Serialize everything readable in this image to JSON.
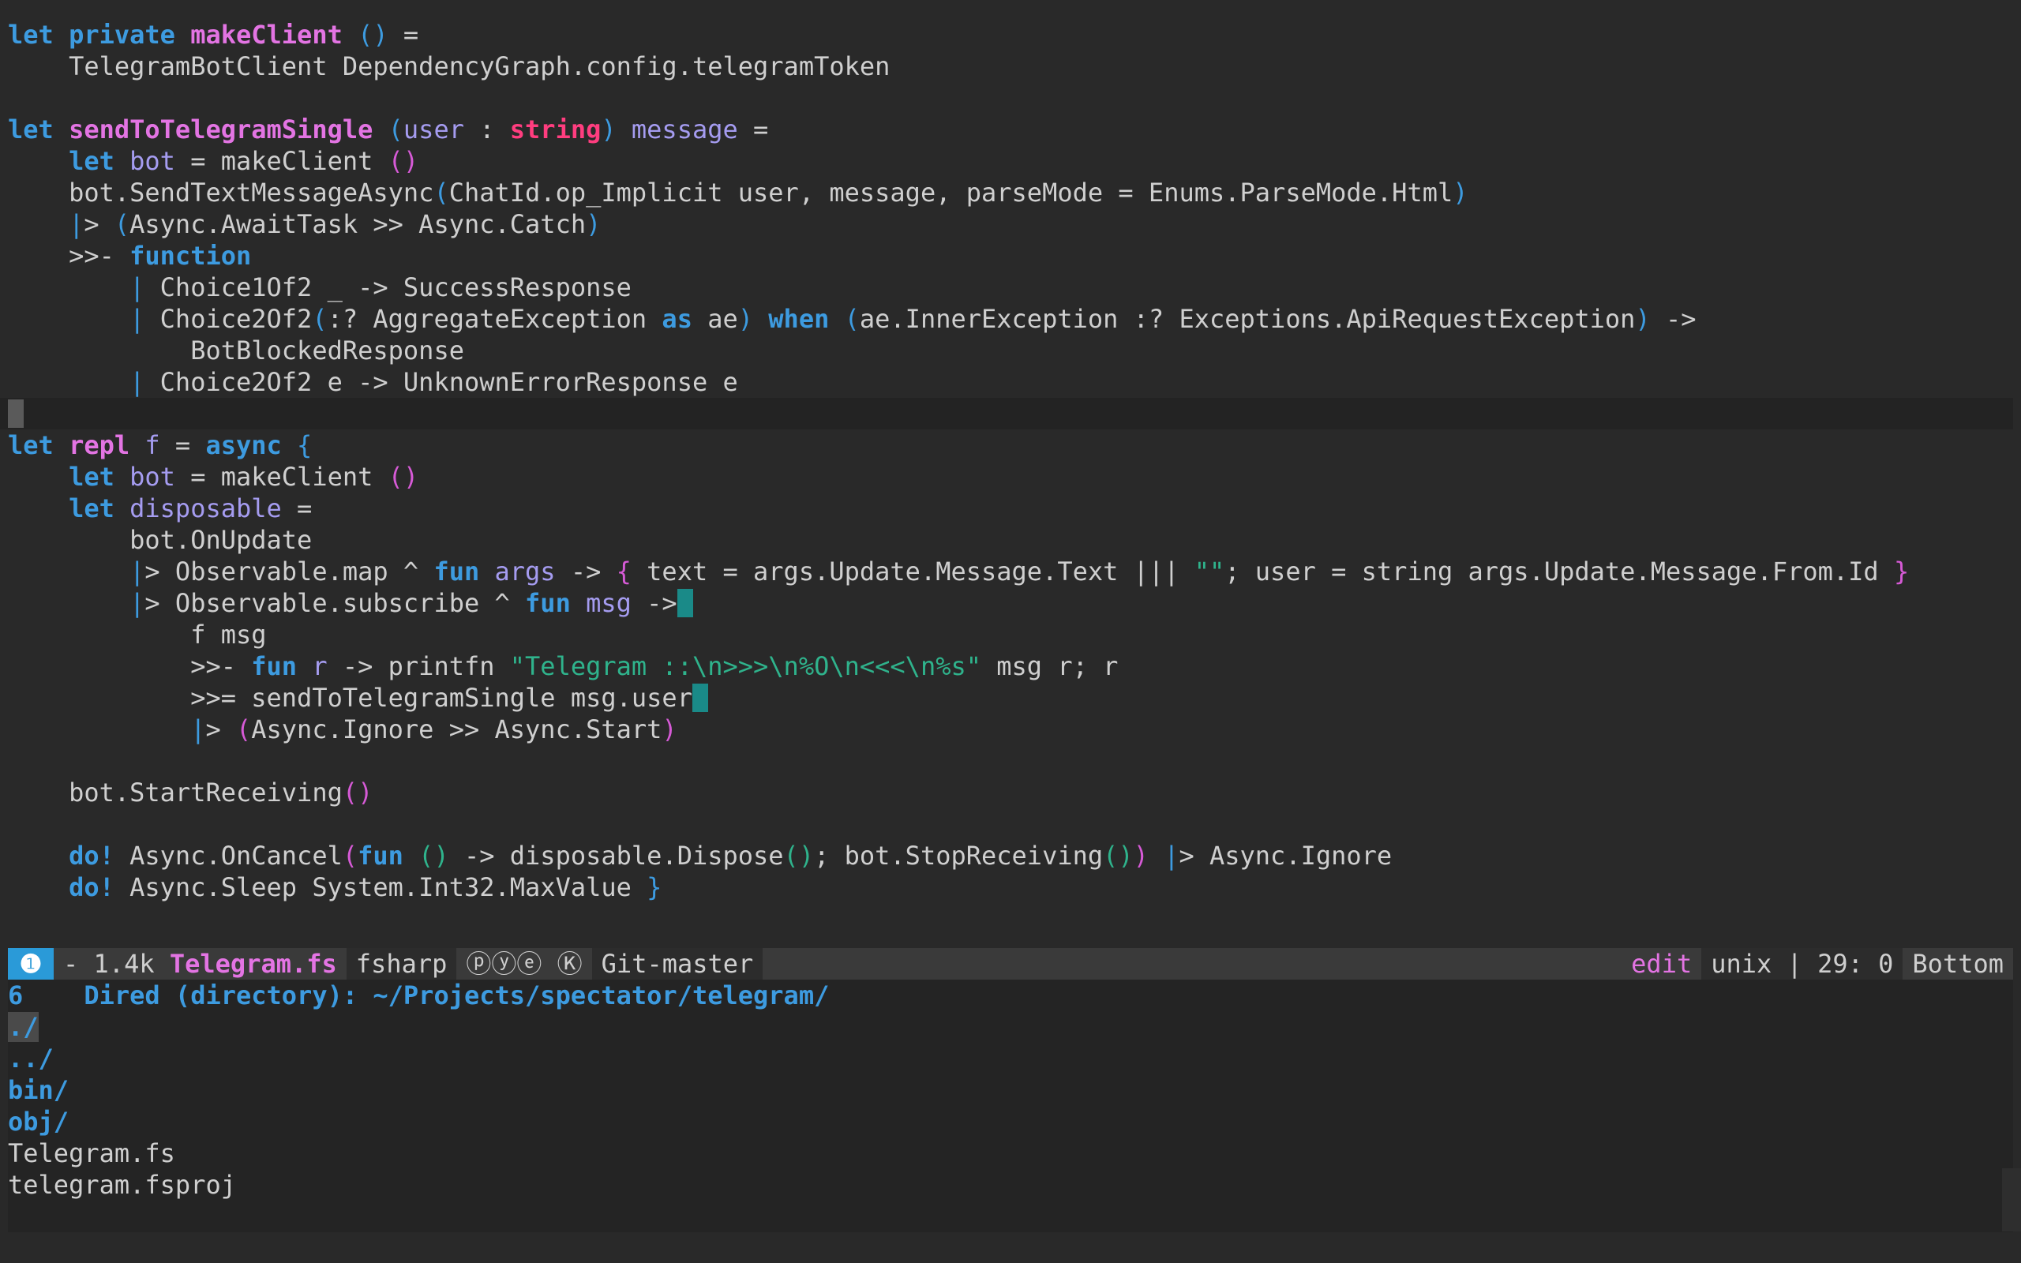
{
  "editor": {
    "lines": [
      {
        "segments": [
          {
            "t": "let",
            "c": "kw"
          },
          {
            "t": " "
          },
          {
            "t": "private",
            "c": "kw"
          },
          {
            "t": " "
          },
          {
            "t": "makeClient",
            "c": "fn"
          },
          {
            "t": " "
          },
          {
            "t": "()",
            "c": "p1"
          },
          {
            "t": " ="
          }
        ]
      },
      {
        "segments": [
          {
            "t": "    TelegramBotClient DependencyGraph.config.telegramToken"
          }
        ]
      },
      {
        "segments": []
      },
      {
        "segments": [
          {
            "t": "let",
            "c": "kw"
          },
          {
            "t": " "
          },
          {
            "t": "sendToTelegramSingle",
            "c": "fn"
          },
          {
            "t": " "
          },
          {
            "t": "(",
            "c": "p1"
          },
          {
            "t": "user",
            "c": "pr"
          },
          {
            "t": " : "
          },
          {
            "t": "string",
            "c": "ty"
          },
          {
            "t": ")",
            "c": "p1"
          },
          {
            "t": " "
          },
          {
            "t": "message",
            "c": "pr"
          },
          {
            "t": " ="
          }
        ]
      },
      {
        "segments": [
          {
            "t": "    "
          },
          {
            "t": "let",
            "c": "kw"
          },
          {
            "t": " "
          },
          {
            "t": "bot",
            "c": "pr"
          },
          {
            "t": " = makeClient "
          },
          {
            "t": "()",
            "c": "p2"
          }
        ]
      },
      {
        "segments": [
          {
            "t": "    bot.SendTextMessageAsync"
          },
          {
            "t": "(",
            "c": "p1"
          },
          {
            "t": "ChatId.op_Implicit user, message, parseMode = Enums.ParseMode.Html"
          },
          {
            "t": ")",
            "c": "p1"
          }
        ]
      },
      {
        "segments": [
          {
            "t": "    "
          },
          {
            "t": "|",
            "c": "pipe"
          },
          {
            "t": "> "
          },
          {
            "t": "(",
            "c": "p1"
          },
          {
            "t": "Async.AwaitTask >> Async.Catch"
          },
          {
            "t": ")",
            "c": "p1"
          }
        ]
      },
      {
        "segments": [
          {
            "t": "    >>- "
          },
          {
            "t": "function",
            "c": "kw"
          }
        ]
      },
      {
        "segments": [
          {
            "t": "        "
          },
          {
            "t": "|",
            "c": "pipe"
          },
          {
            "t": " Choice1Of2 _ -> SuccessResponse"
          }
        ]
      },
      {
        "segments": [
          {
            "t": "        "
          },
          {
            "t": "|",
            "c": "pipe"
          },
          {
            "t": " Choice2Of2"
          },
          {
            "t": "(",
            "c": "p1"
          },
          {
            "t": ":? AggregateException "
          },
          {
            "t": "as",
            "c": "kw"
          },
          {
            "t": " ae"
          },
          {
            "t": ")",
            "c": "p1"
          },
          {
            "t": " "
          },
          {
            "t": "when",
            "c": "kw"
          },
          {
            "t": " "
          },
          {
            "t": "(",
            "c": "p1"
          },
          {
            "t": "ae.InnerException :? Exceptions.ApiRequestException"
          },
          {
            "t": ")",
            "c": "p1"
          },
          {
            "t": " ->"
          }
        ]
      },
      {
        "segments": [
          {
            "t": "            BotBlockedResponse"
          }
        ]
      },
      {
        "segments": [
          {
            "t": "        "
          },
          {
            "t": "|",
            "c": "pipe"
          },
          {
            "t": " Choice2Of2 e -> UnknownErrorResponse e"
          }
        ]
      },
      {
        "segments": [],
        "cursor": "block",
        "highlight": true
      },
      {
        "segments": [
          {
            "t": "let",
            "c": "kw"
          },
          {
            "t": " "
          },
          {
            "t": "repl",
            "c": "fn"
          },
          {
            "t": " "
          },
          {
            "t": "f",
            "c": "pr"
          },
          {
            "t": " = "
          },
          {
            "t": "async",
            "c": "kw"
          },
          {
            "t": " "
          },
          {
            "t": "{",
            "c": "p1"
          }
        ]
      },
      {
        "segments": [
          {
            "t": "    "
          },
          {
            "t": "let",
            "c": "kw"
          },
          {
            "t": " "
          },
          {
            "t": "bot",
            "c": "pr"
          },
          {
            "t": " = makeClient "
          },
          {
            "t": "()",
            "c": "p2"
          }
        ]
      },
      {
        "segments": [
          {
            "t": "    "
          },
          {
            "t": "let",
            "c": "kw"
          },
          {
            "t": " "
          },
          {
            "t": "disposable",
            "c": "pr"
          },
          {
            "t": " ="
          }
        ]
      },
      {
        "segments": [
          {
            "t": "        bot.OnUpdate"
          }
        ]
      },
      {
        "segments": [
          {
            "t": "        "
          },
          {
            "t": "|",
            "c": "pipe"
          },
          {
            "t": "> Observable.map ^ "
          },
          {
            "t": "fun",
            "c": "kw"
          },
          {
            "t": " "
          },
          {
            "t": "args",
            "c": "pr"
          },
          {
            "t": " -> "
          },
          {
            "t": "{",
            "c": "p2"
          },
          {
            "t": " text = args.Update.Message.Text ||| "
          },
          {
            "t": "\"\"",
            "c": "st"
          },
          {
            "t": "; user = string args.Update.Message.From.Id "
          },
          {
            "t": "}",
            "c": "p2"
          }
        ]
      },
      {
        "segments": [
          {
            "t": "        "
          },
          {
            "t": "|",
            "c": "pipe"
          },
          {
            "t": "> Observable.subscribe ^ "
          },
          {
            "t": "fun",
            "c": "kw"
          },
          {
            "t": " "
          },
          {
            "t": "msg",
            "c": "pr"
          },
          {
            "t": " ->"
          }
        ],
        "cursor": "cyan"
      },
      {
        "segments": [
          {
            "t": "            f msg"
          }
        ]
      },
      {
        "segments": [
          {
            "t": "            >>- "
          },
          {
            "t": "fun",
            "c": "kw"
          },
          {
            "t": " "
          },
          {
            "t": "r",
            "c": "pr"
          },
          {
            "t": " -> printfn "
          },
          {
            "t": "\"Telegram ::\\n>>>\\n%O\\n<<<\\n%s\"",
            "c": "st"
          },
          {
            "t": " msg r; r"
          }
        ]
      },
      {
        "segments": [
          {
            "t": "            >>= sendToTelegramSingle msg.user"
          }
        ],
        "cursor": "cyan"
      },
      {
        "segments": [
          {
            "t": "            "
          },
          {
            "t": "|",
            "c": "pipe"
          },
          {
            "t": "> "
          },
          {
            "t": "(",
            "c": "p2"
          },
          {
            "t": "Async.Ignore >> Async.Start"
          },
          {
            "t": ")",
            "c": "p2"
          }
        ]
      },
      {
        "segments": []
      },
      {
        "segments": [
          {
            "t": "    bot.StartReceiving"
          },
          {
            "t": "()",
            "c": "p2"
          }
        ]
      },
      {
        "segments": []
      },
      {
        "segments": [
          {
            "t": "    "
          },
          {
            "t": "do!",
            "c": "kw"
          },
          {
            "t": " Async.OnCancel"
          },
          {
            "t": "(",
            "c": "p2"
          },
          {
            "t": "fun",
            "c": "kw"
          },
          {
            "t": " "
          },
          {
            "t": "()",
            "c": "p3"
          },
          {
            "t": " -> disposable.Dispose"
          },
          {
            "t": "()",
            "c": "p3"
          },
          {
            "t": "; bot.StopReceiving"
          },
          {
            "t": "()",
            "c": "p3"
          },
          {
            "t": ")",
            "c": "p2"
          },
          {
            "t": " "
          },
          {
            "t": "|",
            "c": "pipe"
          },
          {
            "t": "> Async.Ignore"
          }
        ]
      },
      {
        "segments": [
          {
            "t": "    "
          },
          {
            "t": "do!",
            "c": "kw"
          },
          {
            "t": " Async.Sleep System.Int32.MaxValue "
          },
          {
            "t": "}",
            "c": "p1"
          }
        ]
      }
    ]
  },
  "modeline": {
    "window_number": "❶",
    "modified": "-",
    "size": "1.4k",
    "filename": "Telegram.fs",
    "major_mode": "fsharp",
    "minor_modes": "ⓟⓨⓔ Ⓚ",
    "vcs": "Git-master",
    "state": "edit",
    "eol": "unix",
    "position": "29: 0",
    "scroll": "Bottom"
  },
  "dired": {
    "header_num": "6",
    "header": "Dired (directory): ~/Projects/spectator/telegram/",
    "entries": [
      {
        "name": "./",
        "kind": "dir",
        "selected": true
      },
      {
        "name": "../",
        "kind": "dir"
      },
      {
        "name": "bin/",
        "kind": "dir"
      },
      {
        "name": "obj/",
        "kind": "dir"
      },
      {
        "name": "Telegram.fs",
        "kind": "file"
      },
      {
        "name": "telegram.fsproj",
        "kind": "file"
      }
    ]
  }
}
